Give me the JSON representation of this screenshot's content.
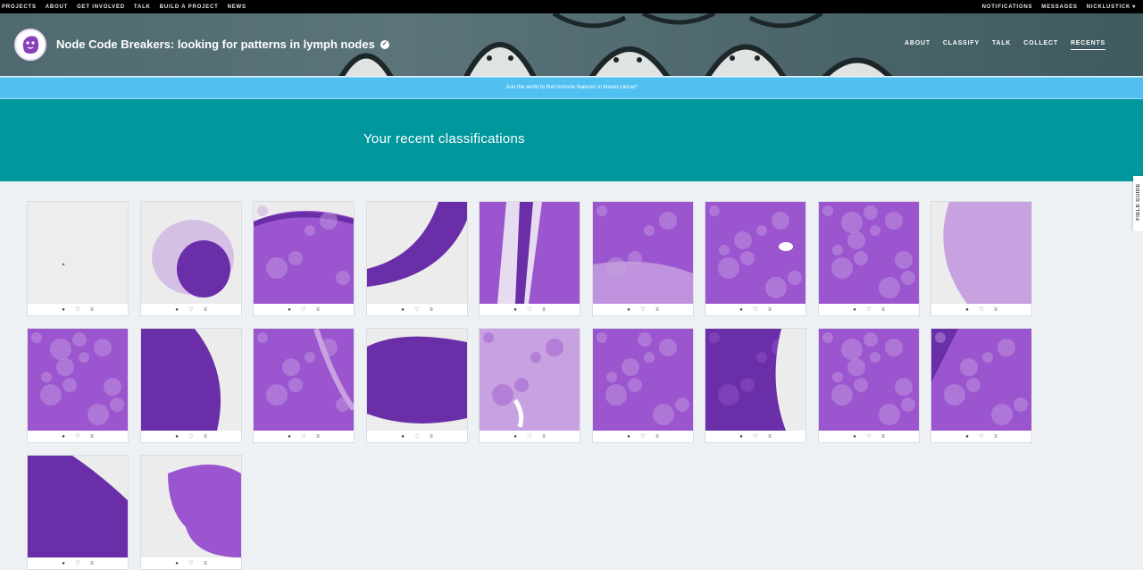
{
  "topbar": {
    "left": [
      "PROJECTS",
      "ABOUT",
      "GET INVOLVED",
      "TALK",
      "BUILD A PROJECT",
      "NEWS"
    ],
    "notifications": "NOTIFICATIONS",
    "messages": "MESSAGES",
    "user": "NICKLUSTICK"
  },
  "project": {
    "title": "Node Code Breakers: looking for patterns in lymph nodes",
    "nav": [
      "ABOUT",
      "CLASSIFY",
      "TALK",
      "COLLECT",
      "RECENTS"
    ],
    "active_nav": "RECENTS"
  },
  "announcement": "Join the world to find immune features in breast cancer!",
  "page_title": "Your recent classifications",
  "field_guide": "FIELD GUIDE",
  "colors": {
    "topbar": "#000000",
    "announcement": "#4fc0f0",
    "hero": "#00979d",
    "tissue_dark": "#6a2fa8",
    "tissue_mid": "#9a55cf",
    "tissue_light": "#c8a1e0",
    "slide_bg": "#ececec"
  },
  "card_actions": [
    "info-icon",
    "heart-icon",
    "collect-icon"
  ],
  "classifications": [
    {
      "kind": "blank"
    },
    {
      "kind": "blob"
    },
    {
      "kind": "band-top"
    },
    {
      "kind": "curve"
    },
    {
      "kind": "fat-stripe"
    },
    {
      "kind": "mixed-light"
    },
    {
      "kind": "dense-duct"
    },
    {
      "kind": "dense-follicles"
    },
    {
      "kind": "pale"
    },
    {
      "kind": "dense-follicles"
    },
    {
      "kind": "edge-right"
    },
    {
      "kind": "dense-vessel"
    },
    {
      "kind": "fat-top"
    },
    {
      "kind": "pale-vessel"
    },
    {
      "kind": "mixed"
    },
    {
      "kind": "edge-right-dense"
    },
    {
      "kind": "dense-follicles"
    },
    {
      "kind": "corner-dark"
    },
    {
      "kind": "dense-dark"
    },
    {
      "kind": "edge-left-blob"
    }
  ]
}
